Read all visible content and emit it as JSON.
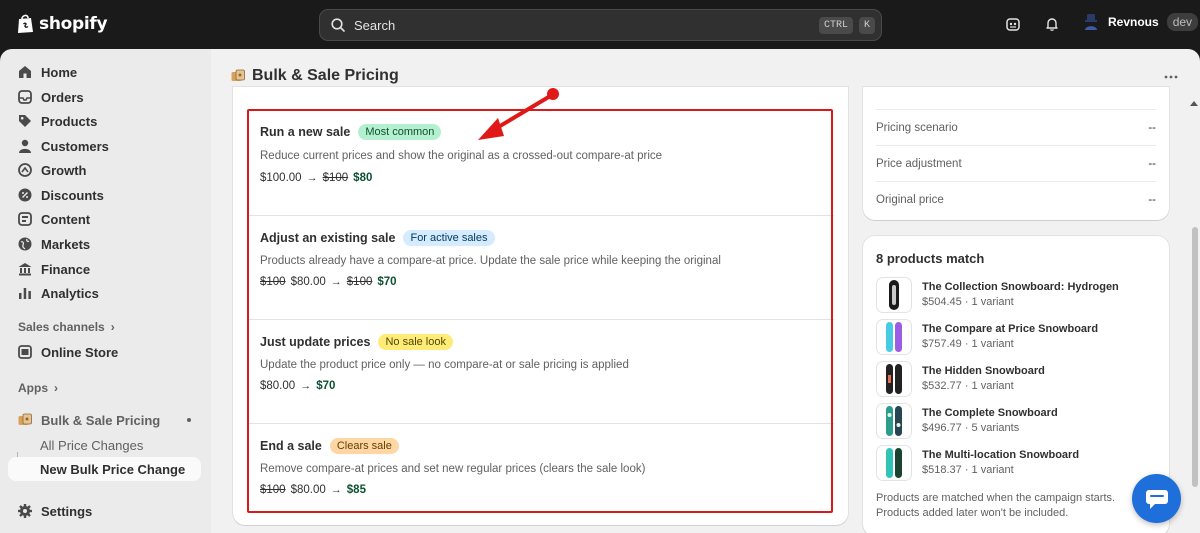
{
  "topbar": {
    "brand": "shopify",
    "search_placeholder": "Search",
    "shortcut_keys": [
      "CTRL",
      "K"
    ],
    "user_name": "Revnous",
    "user_badge": "dev"
  },
  "sidebar": {
    "items": [
      {
        "label": "Home",
        "icon": "home-icon"
      },
      {
        "label": "Orders",
        "icon": "orders-icon"
      },
      {
        "label": "Products",
        "icon": "tag-icon"
      },
      {
        "label": "Customers",
        "icon": "person-icon"
      },
      {
        "label": "Growth",
        "icon": "growth-icon"
      },
      {
        "label": "Discounts",
        "icon": "discount-icon"
      },
      {
        "label": "Content",
        "icon": "content-icon"
      },
      {
        "label": "Markets",
        "icon": "globe-icon"
      },
      {
        "label": "Finance",
        "icon": "bank-icon"
      },
      {
        "label": "Analytics",
        "icon": "chart-icon"
      }
    ],
    "sales_channels_label": "Sales channels",
    "online_store_label": "Online Store",
    "apps_label": "Apps",
    "app_name": "Bulk & Sale Pricing",
    "app_subitems": [
      "All Price Changes",
      "New Bulk Price Change"
    ],
    "settings_label": "Settings"
  },
  "page": {
    "title": "Bulk & Sale Pricing"
  },
  "options": [
    {
      "title": "Run a new sale",
      "badge": "Most common",
      "badge_bg": "#b4f0cf",
      "badge_fg": "#0c5132",
      "description": "Reduce current prices and show the original as a crossed-out compare-at price",
      "price_before": "$100.00",
      "price_before_strike": "",
      "arrow": "→",
      "price_after_strike": "$100",
      "price_after": "$80"
    },
    {
      "title": "Adjust an existing sale",
      "badge": "For active sales",
      "badge_bg": "#d5ebff",
      "badge_fg": "#003a5a",
      "description": "Products already have a compare-at price. Update the sale price while keeping the original",
      "price_before_strike": "$100",
      "price_before": "$80.00",
      "arrow": "→",
      "price_after_strike": "$100",
      "price_after": "$70"
    },
    {
      "title": "Just update prices",
      "badge": "No sale look",
      "badge_bg": "#ffeb78",
      "badge_fg": "#4f4700",
      "description": "Update the product price only — no compare-at or sale pricing is applied",
      "price_before_strike": "",
      "price_before": "$80.00",
      "arrow": "→",
      "price_after_strike": "",
      "price_after": "$70"
    },
    {
      "title": "End a sale",
      "badge": "Clears sale",
      "badge_bg": "#ffd6a4",
      "badge_fg": "#5e4200",
      "description": "Remove compare-at prices and set new regular prices (clears the sale look)",
      "price_before_strike": "$100",
      "price_before": "$80.00",
      "arrow": "→",
      "price_after_strike": "",
      "price_after": "$85"
    }
  ],
  "summary": {
    "rows": [
      {
        "label": "Pricing scenario",
        "value": "--"
      },
      {
        "label": "Price adjustment",
        "value": "--"
      },
      {
        "label": "Original price",
        "value": "--"
      }
    ]
  },
  "matches": {
    "title": "8 products match",
    "products": [
      {
        "name": "The Collection Snowboard: Hydrogen",
        "meta": "$504.45 · 1 variant",
        "colors": [
          "#1a1a1a",
          "#c9c9c9"
        ]
      },
      {
        "name": "The Compare at Price Snowboard",
        "meta": "$757.49 · 1 variant",
        "colors": [
          "#9b5de5",
          "#48cae4"
        ]
      },
      {
        "name": "The Hidden Snowboard",
        "meta": "$532.77 · 1 variant",
        "colors": [
          "#222222",
          "#e76f51"
        ]
      },
      {
        "name": "The Complete Snowboard",
        "meta": "$496.77 · 5 variants",
        "colors": [
          "#2a9d8f",
          "#264653"
        ]
      },
      {
        "name": "The Multi-location Snowboard",
        "meta": "$518.37 · 1 variant",
        "colors": [
          "#2ec4b6",
          "#1b4332"
        ]
      }
    ],
    "note": "Products are matched when the campaign starts. Products added later won't be included."
  }
}
